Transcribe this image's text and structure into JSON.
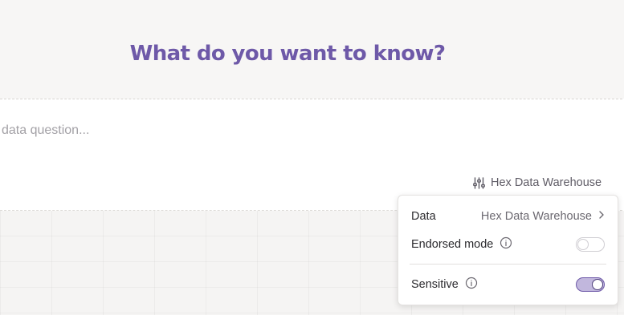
{
  "heading": "What do you want to know?",
  "prompt": {
    "placeholder": "data question...",
    "value": ""
  },
  "data_source_button": {
    "icon": "sliders-icon",
    "label": "Hex Data Warehouse"
  },
  "settings_popover": {
    "data_row": {
      "label": "Data",
      "value": "Hex Data Warehouse",
      "icon": "chevron-right-icon"
    },
    "endorsed_mode": {
      "label": "Endorsed mode",
      "info_icon": "info-icon",
      "enabled": false
    },
    "sensitive": {
      "label": "Sensitive",
      "info_icon": "info-icon",
      "enabled": true
    }
  },
  "colors": {
    "accent": "#6e59a8",
    "toggle_on_fill": "#c1b7dd",
    "muted_text": "#a3a1a6"
  }
}
